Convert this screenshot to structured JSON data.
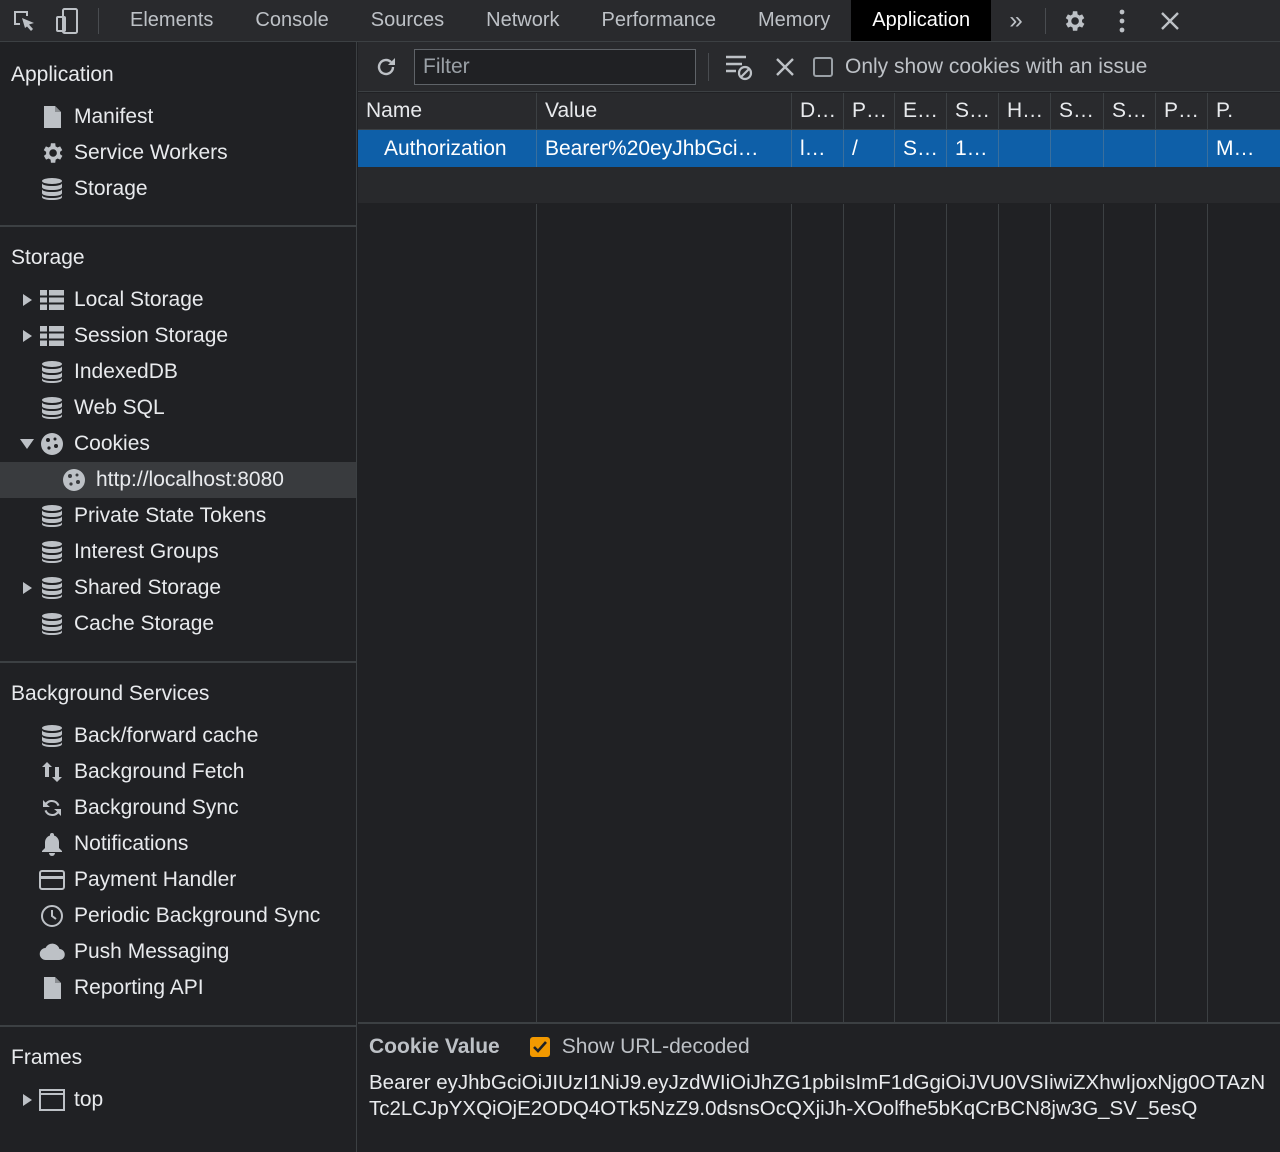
{
  "topbar": {
    "tabs": [
      "Elements",
      "Console",
      "Sources",
      "Network",
      "Performance",
      "Memory",
      "Application"
    ],
    "active_tab": "Application",
    "overflow_glyph": "»"
  },
  "sidebar": {
    "application": {
      "title": "Application",
      "items": [
        {
          "label": "Manifest",
          "icon": "file-icon"
        },
        {
          "label": "Service Workers",
          "icon": "gear-icon"
        },
        {
          "label": "Storage",
          "icon": "database-icon"
        }
      ]
    },
    "storage": {
      "title": "Storage",
      "items": [
        {
          "label": "Local Storage",
          "icon": "table-icon"
        },
        {
          "label": "Session Storage",
          "icon": "table-icon"
        },
        {
          "label": "IndexedDB",
          "icon": "database-icon"
        },
        {
          "label": "Web SQL",
          "icon": "database-icon"
        },
        {
          "label": "Cookies",
          "icon": "cookie-icon"
        },
        {
          "label": "http://localhost:8080",
          "icon": "cookie-icon"
        },
        {
          "label": "Private State Tokens",
          "icon": "database-icon"
        },
        {
          "label": "Interest Groups",
          "icon": "database-icon"
        },
        {
          "label": "Shared Storage",
          "icon": "database-icon"
        },
        {
          "label": "Cache Storage",
          "icon": "database-icon"
        }
      ]
    },
    "background": {
      "title": "Background Services",
      "items": [
        {
          "label": "Back/forward cache",
          "icon": "database-icon"
        },
        {
          "label": "Background Fetch",
          "icon": "up-down-arrows-icon"
        },
        {
          "label": "Background Sync",
          "icon": "sync-icon"
        },
        {
          "label": "Notifications",
          "icon": "bell-icon"
        },
        {
          "label": "Payment Handler",
          "icon": "card-icon"
        },
        {
          "label": "Periodic Background Sync",
          "icon": "clock-icon"
        },
        {
          "label": "Push Messaging",
          "icon": "cloud-icon"
        },
        {
          "label": "Reporting API",
          "icon": "file-icon"
        }
      ]
    },
    "frames": {
      "title": "Frames",
      "items": [
        {
          "label": "top",
          "icon": "frame-icon"
        }
      ]
    }
  },
  "toolbar": {
    "filter_placeholder": "Filter",
    "only_issue_label": "Only show cookies with an issue",
    "only_issue_checked": false
  },
  "table": {
    "headers": [
      "Name",
      "Value",
      "D…",
      "P…",
      "E…",
      "S…",
      "H…",
      "S…",
      "S…",
      "P…",
      "P."
    ],
    "rows": [
      [
        "Authorization",
        "Bearer%20eyJhbGci…",
        "l…",
        "/",
        "S…",
        "1…",
        "",
        "",
        "",
        "",
        "M…"
      ]
    ]
  },
  "detail": {
    "title": "Cookie Value",
    "decode_label": "Show URL-decoded",
    "decode_checked": true,
    "value": "Bearer eyJhbGciOiJIUzI1NiJ9.eyJzdWIiOiJhZG1pbiIsImF1dGgiOiJVU0VSIiwiZXhwIjoxNjg0OTAzNTc2LCJpYXQiOjE2ODQ4OTk5NzZ9.0dsnsOcQXjiJh-XOolfhe5bKqCrBCN8jw3G_SV_5esQ"
  },
  "colors": {
    "selection": "#0e5fa8",
    "checkbox_on": "#f29900",
    "background": "#202124"
  }
}
